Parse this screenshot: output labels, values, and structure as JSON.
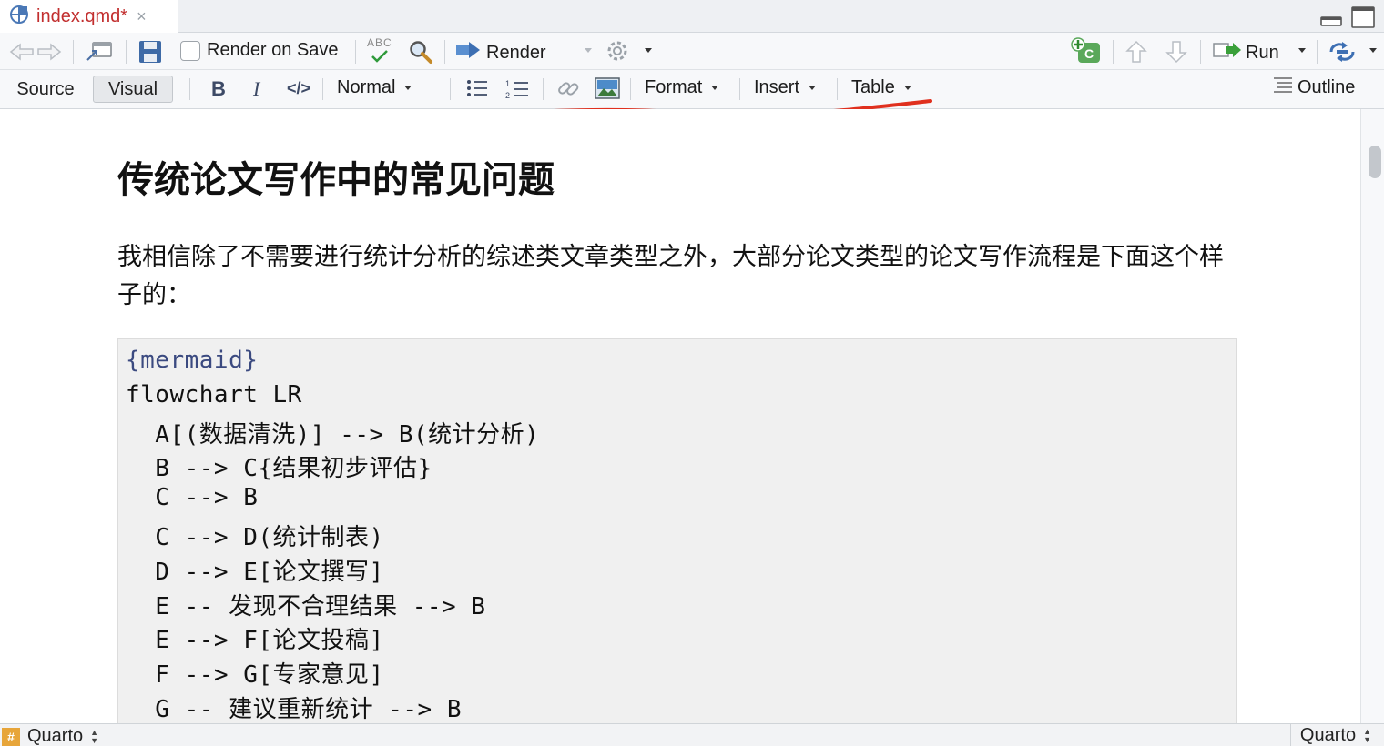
{
  "tab": {
    "title": "index.qmd*",
    "close": "×"
  },
  "toolbar": {
    "render_on_save": "Render on Save",
    "spell_label": "ABC",
    "render": "Render",
    "run": "Run"
  },
  "format_bar": {
    "source": "Source",
    "visual": "Visual",
    "bold": "B",
    "italic": "I",
    "code": "</>",
    "block_format": "Normal",
    "format_menu": "Format",
    "insert_menu": "Insert",
    "table_menu": "Table",
    "outline": "Outline"
  },
  "document": {
    "heading": "传统论文写作中的常见问题",
    "paragraph": "我相信除了不需要进行统计分析的综述类文章类型之外，大部分论文类型的论文写作流程是下面这个样子的：",
    "code_lines": [
      "{mermaid}",
      "flowchart LR",
      "  A[(数据清洗)] --> B(统计分析)",
      "  B --> C{结果初步评估}",
      "  C --> B",
      "  C --> D(统计制表)",
      "  D --> E[论文撰写]",
      "  E -- 发现不合理结果 --> B",
      "  E --> F[论文投稿]",
      "  F --> G[专家意见]",
      "  G -- 建议重新统计 --> B"
    ]
  },
  "status": {
    "left_mode": "Quarto",
    "right_mode": "Quarto",
    "badge": "#"
  },
  "colors": {
    "tab_title": "#c22f2f",
    "annotation": "#e0301e",
    "quarto_badge": "#e7a53a"
  }
}
